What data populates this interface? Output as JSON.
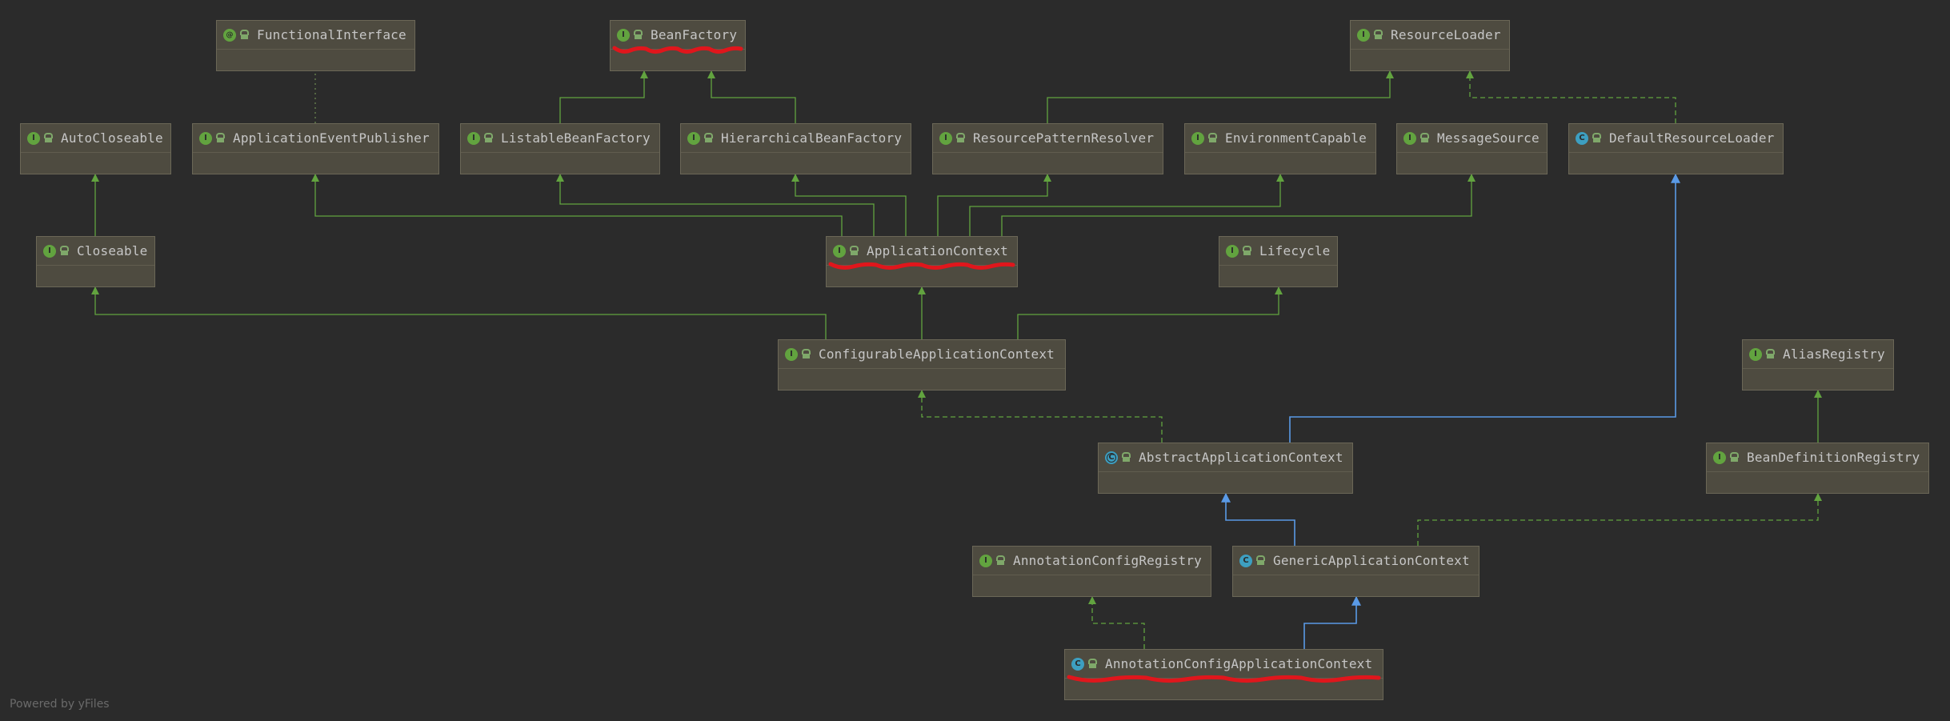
{
  "diagram": {
    "nodes": [
      {
        "id": "FunctionalInterface",
        "label": "FunctionalInterface",
        "kind": "at"
      },
      {
        "id": "BeanFactory",
        "label": "BeanFactory",
        "kind": "i"
      },
      {
        "id": "ResourceLoader",
        "label": "ResourceLoader",
        "kind": "i"
      },
      {
        "id": "AutoCloseable",
        "label": "AutoCloseable",
        "kind": "i"
      },
      {
        "id": "ApplicationEventPublisher",
        "label": "ApplicationEventPublisher",
        "kind": "i"
      },
      {
        "id": "ListableBeanFactory",
        "label": "ListableBeanFactory",
        "kind": "i"
      },
      {
        "id": "HierarchicalBeanFactory",
        "label": "HierarchicalBeanFactory",
        "kind": "i"
      },
      {
        "id": "ResourcePatternResolver",
        "label": "ResourcePatternResolver",
        "kind": "i"
      },
      {
        "id": "EnvironmentCapable",
        "label": "EnvironmentCapable",
        "kind": "i"
      },
      {
        "id": "MessageSource",
        "label": "MessageSource",
        "kind": "i"
      },
      {
        "id": "DefaultResourceLoader",
        "label": "DefaultResourceLoader",
        "kind": "c"
      },
      {
        "id": "Closeable",
        "label": "Closeable",
        "kind": "i"
      },
      {
        "id": "ApplicationContext",
        "label": "ApplicationContext",
        "kind": "i"
      },
      {
        "id": "Lifecycle",
        "label": "Lifecycle",
        "kind": "i"
      },
      {
        "id": "ConfigurableApplicationContext",
        "label": "ConfigurableApplicationContext",
        "kind": "i"
      },
      {
        "id": "AliasRegistry",
        "label": "AliasRegistry",
        "kind": "i"
      },
      {
        "id": "AbstractApplicationContext",
        "label": "AbstractApplicationContext",
        "kind": "a"
      },
      {
        "id": "BeanDefinitionRegistry",
        "label": "BeanDefinitionRegistry",
        "kind": "i"
      },
      {
        "id": "AnnotationConfigRegistry",
        "label": "AnnotationConfigRegistry",
        "kind": "i"
      },
      {
        "id": "GenericApplicationContext",
        "label": "GenericApplicationContext",
        "kind": "c"
      },
      {
        "id": "AnnotationConfigApplicationContext",
        "label": "AnnotationConfigApplicationContext",
        "kind": "c"
      }
    ],
    "edges": [
      {
        "from": "ApplicationEventPublisher",
        "to": "FunctionalInterface",
        "style": "annotation"
      },
      {
        "from": "ListableBeanFactory",
        "to": "BeanFactory",
        "style": "extends-interface"
      },
      {
        "from": "HierarchicalBeanFactory",
        "to": "BeanFactory",
        "style": "extends-interface"
      },
      {
        "from": "ResourcePatternResolver",
        "to": "ResourceLoader",
        "style": "extends-interface"
      },
      {
        "from": "DefaultResourceLoader",
        "to": "ResourceLoader",
        "style": "implements"
      },
      {
        "from": "Closeable",
        "to": "AutoCloseable",
        "style": "extends-interface"
      },
      {
        "from": "ApplicationContext",
        "to": "ApplicationEventPublisher",
        "style": "extends-interface"
      },
      {
        "from": "ApplicationContext",
        "to": "ListableBeanFactory",
        "style": "extends-interface"
      },
      {
        "from": "ApplicationContext",
        "to": "HierarchicalBeanFactory",
        "style": "extends-interface"
      },
      {
        "from": "ApplicationContext",
        "to": "ResourcePatternResolver",
        "style": "extends-interface"
      },
      {
        "from": "ApplicationContext",
        "to": "EnvironmentCapable",
        "style": "extends-interface"
      },
      {
        "from": "ApplicationContext",
        "to": "MessageSource",
        "style": "extends-interface"
      },
      {
        "from": "ConfigurableApplicationContext",
        "to": "Closeable",
        "style": "extends-interface"
      },
      {
        "from": "ConfigurableApplicationContext",
        "to": "ApplicationContext",
        "style": "extends-interface"
      },
      {
        "from": "ConfigurableApplicationContext",
        "to": "Lifecycle",
        "style": "extends-interface"
      },
      {
        "from": "AbstractApplicationContext",
        "to": "ConfigurableApplicationContext",
        "style": "implements"
      },
      {
        "from": "AbstractApplicationContext",
        "to": "DefaultResourceLoader",
        "style": "extends-class"
      },
      {
        "from": "BeanDefinitionRegistry",
        "to": "AliasRegistry",
        "style": "extends-interface"
      },
      {
        "from": "GenericApplicationContext",
        "to": "AbstractApplicationContext",
        "style": "extends-class"
      },
      {
        "from": "GenericApplicationContext",
        "to": "BeanDefinitionRegistry",
        "style": "implements"
      },
      {
        "from": "AnnotationConfigApplicationContext",
        "to": "AnnotationConfigRegistry",
        "style": "implements"
      },
      {
        "from": "AnnotationConfigApplicationContext",
        "to": "GenericApplicationContext",
        "style": "extends-class"
      }
    ],
    "highlighted": [
      "BeanFactory",
      "ApplicationContext",
      "AnnotationConfigApplicationContext"
    ],
    "colors": {
      "interface_edge": "#62a33f",
      "class_edge": "#5a9ae6",
      "highlight": "#e0161c",
      "node_fill": "#4e4b40",
      "background": "#2b2b2b"
    }
  },
  "footer": {
    "powered_by": "Powered by yFiles"
  }
}
